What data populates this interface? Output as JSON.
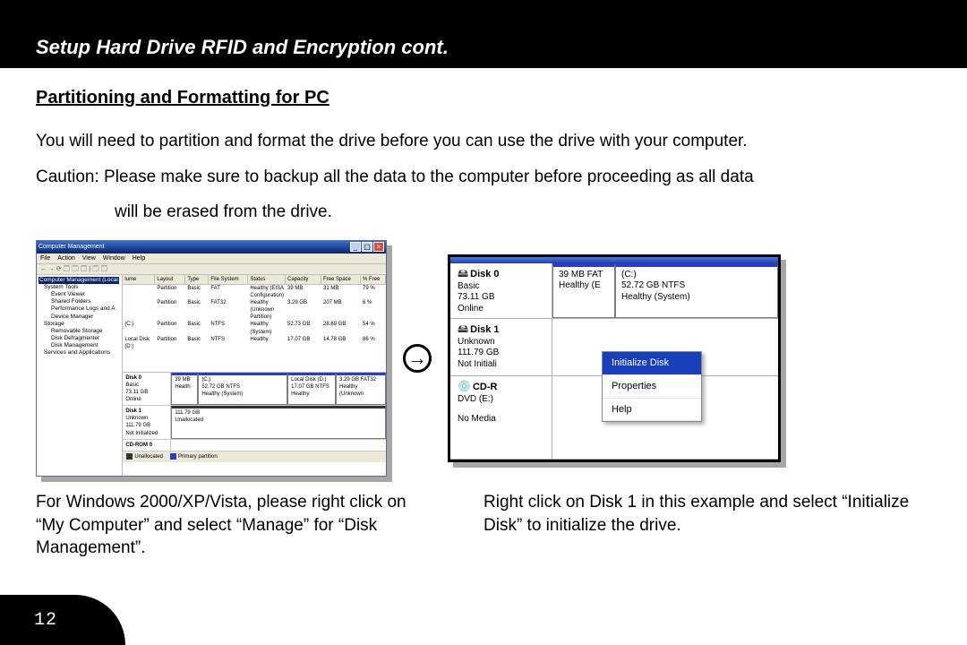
{
  "header": {
    "title": "Setup Hard Drive RFID and Encryption cont."
  },
  "section": {
    "heading": "Partitioning and Formatting for PC"
  },
  "body": {
    "p1": "You will need to partition and format the drive before you can use the drive with your computer.",
    "p2a": "Caution: Please make sure to backup all the data to the computer before proceeding as all data",
    "p2b": "will be erased from the drive."
  },
  "fig1": {
    "windowTitle": "Computer Management",
    "menu": [
      "File",
      "Action",
      "View",
      "Window",
      "Help"
    ],
    "toolbar": "←  →  ⟳  🗔 🗔 🗔 | 🗔 🗔",
    "tree": {
      "root": "Computer Management (Local",
      "systemTools": "System Tools",
      "eventViewer": "Event Viewer",
      "sharedFolders": "Shared Folders",
      "perf": "Performance Logs and A",
      "devmgr": "Device Manager",
      "storage": "Storage",
      "removable": "Removable Storage",
      "defrag": "Disk Defragmenter",
      "diskmgmt": "Disk Management",
      "services": "Services and Applications"
    },
    "columns": [
      "lume",
      "Layout",
      "Type",
      "File System",
      "Status",
      "Capacity",
      "Free Space",
      "% Free"
    ],
    "rows": [
      [
        "",
        "Partition",
        "Basic",
        "FAT",
        "Healthy (EISA Configuration)",
        "39 MB",
        "31 MB",
        "79 %"
      ],
      [
        "",
        "Partition",
        "Basic",
        "FAT32",
        "Healthy (Unknown Partition)",
        "3.29 GB",
        "207 MB",
        "6 %"
      ],
      [
        "(C:)",
        "Partition",
        "Basic",
        "NTFS",
        "Healthy (System)",
        "52.73 GB",
        "28.69 GB",
        "54 %"
      ],
      [
        "Local Disk (D:)",
        "Partition",
        "Basic",
        "NTFS",
        "Healthy",
        "17.07 GB",
        "14.78 GB",
        "86 %"
      ]
    ],
    "disk0": {
      "name": "Disk 0",
      "type": "Basic",
      "size": "73.11 GB",
      "status": "Online",
      "parts": [
        {
          "t1": "",
          "t2": "39 MB",
          "t3": "Health"
        },
        {
          "t1": "(C:)",
          "t2": "52.72 GB NTFS",
          "t3": "Healthy (System)"
        },
        {
          "t1": "Local Disk (D:)",
          "t2": "17.07 GB NTFS",
          "t3": "Healthy"
        },
        {
          "t1": "",
          "t2": "3.29 GB FAT32",
          "t3": "Healthy (Unknown"
        }
      ]
    },
    "disk1": {
      "name": "Disk 1",
      "type": "Unknown",
      "size": "111.79 GB",
      "status": "Not Initialized",
      "parts": [
        {
          "t1": "",
          "t2": "111.79 GB",
          "t3": "Unallocated"
        }
      ]
    },
    "cdrom": {
      "name": "CD-ROM 0"
    },
    "legend": {
      "a": "Unallocated",
      "b": "Primary partition"
    }
  },
  "fig2": {
    "disk0": {
      "name": "Disk 0",
      "type": "Basic",
      "size": "73.11 GB",
      "status": "Online",
      "parts": [
        {
          "t1": "",
          "t2": "39 MB FAT",
          "t3": "Healthy (E"
        },
        {
          "t1": "(C:)",
          "t2": "52.72 GB NTFS",
          "t3": "Healthy (System)"
        }
      ]
    },
    "disk1": {
      "name": "Disk 1",
      "type": "Unknown",
      "size": "111.79 GB",
      "status": "Not Initiali"
    },
    "cdrom": {
      "name": "CD-R",
      "sub": "DVD (E:)",
      "media": "No Media"
    },
    "menu": {
      "init": "Initialize Disk",
      "prop": "Properties",
      "help": "Help"
    }
  },
  "captions": {
    "left": "For Windows 2000/XP/Vista, please right click on “My Computer” and select “Manage” for “Disk Management”.",
    "right": "Right click on Disk 1 in this example and select “Initialize Disk” to initialize the drive."
  },
  "page": {
    "number": "12"
  }
}
